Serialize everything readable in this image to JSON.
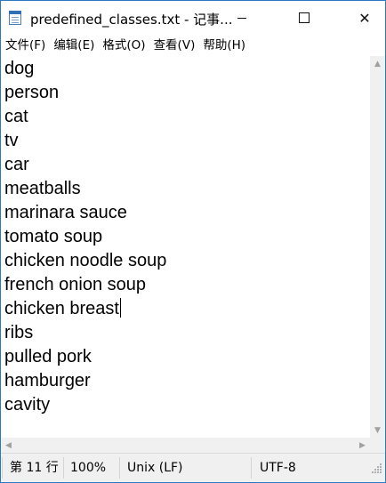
{
  "window": {
    "title": "predefined_classes.txt - 记事...",
    "icon": "notepad-icon",
    "controls": [
      "minimize-icon",
      "maximize-icon",
      "close-icon"
    ],
    "close_glyph": "✕"
  },
  "menu": {
    "file": "文件(F)",
    "edit": "编辑(E)",
    "format": "格式(O)",
    "view": "查看(V)",
    "help": "帮助(H)"
  },
  "editor": {
    "lines": [
      "dog",
      "person",
      "cat",
      "tv",
      "car",
      "meatballs",
      "marinara sauce",
      "tomato soup",
      "chicken noodle soup",
      "french onion soup",
      "chicken breast",
      "ribs",
      "pulled pork",
      "hamburger",
      "cavity"
    ],
    "caret_line": 11
  },
  "scrollbars": {
    "up": "▲",
    "down": "▼",
    "left": "◀",
    "right": "▶"
  },
  "status": {
    "position": "第 11 行",
    "zoom": "100%",
    "line_ending": "Unix (LF)",
    "encoding": "UTF-8"
  }
}
